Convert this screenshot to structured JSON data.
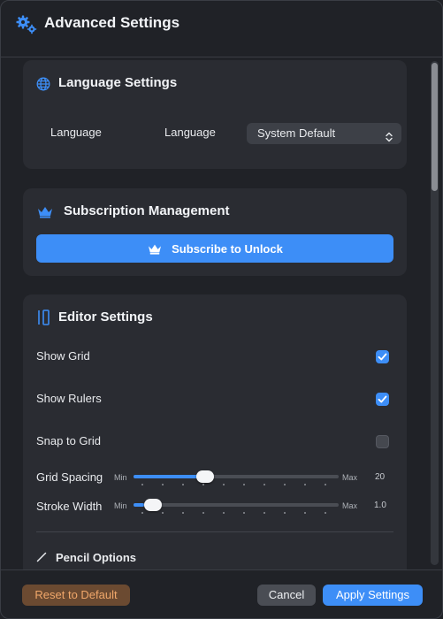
{
  "window": {
    "title": "Advanced Settings"
  },
  "language": {
    "title": "Language Settings",
    "row_label": "Language",
    "field_label": "Language",
    "selected": "System Default"
  },
  "subscription": {
    "title": "Subscription Management",
    "button_label": "Subscribe to Unlock"
  },
  "editor": {
    "title": "Editor Settings",
    "toggles": [
      {
        "label": "Show Grid",
        "checked": true
      },
      {
        "label": "Show Rulers",
        "checked": true
      },
      {
        "label": "Snap to Grid",
        "checked": false
      }
    ],
    "sliders": [
      {
        "label": "Grid Spacing",
        "min_label": "Min",
        "max_label": "Max",
        "value": "20",
        "fraction": 0.35
      },
      {
        "label": "Stroke Width",
        "min_label": "Min",
        "max_label": "Max",
        "value": "1.0",
        "fraction": 0.05
      }
    ],
    "pencil_label": "Pencil Options"
  },
  "footer": {
    "reset_label": "Reset to Default",
    "cancel_label": "Cancel",
    "apply_label": "Apply Settings"
  },
  "colors": {
    "accent": "#3d8ef7",
    "reset_text": "#f0a76a"
  }
}
